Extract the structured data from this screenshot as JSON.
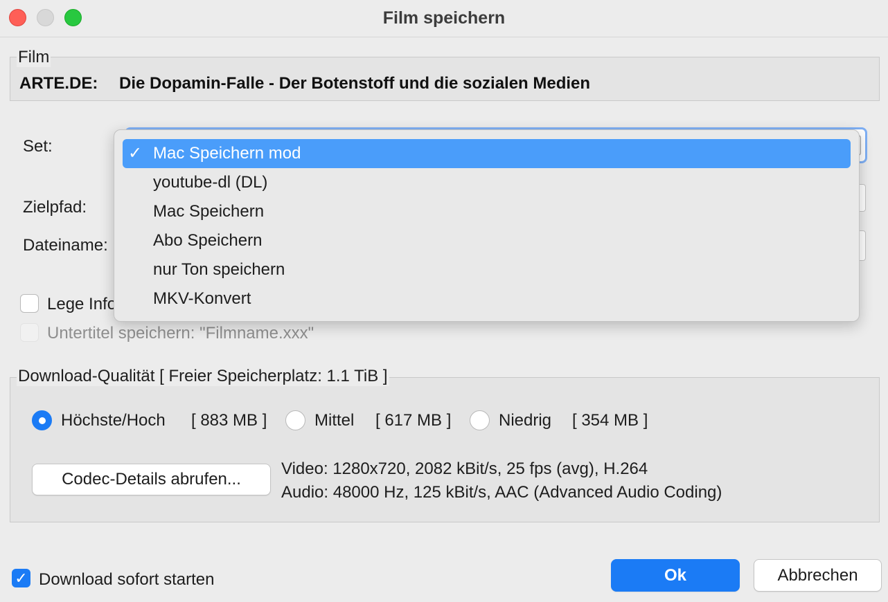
{
  "window": {
    "title": "Film speichern"
  },
  "film": {
    "legend": "Film",
    "station": "ARTE.DE:",
    "name": "Die Dopamin-Falle - Der Botenstoff und die sozialen Medien"
  },
  "form": {
    "set_label": "Set:",
    "path_label": "Zielpfad:",
    "filename_label": "Dateiname:"
  },
  "set_dropdown": {
    "selected": "Mac Speichern mod",
    "options": [
      "Mac Speichern mod",
      "youtube-dl (DL)",
      "Mac Speichern",
      "Abo Speichern",
      "nur Ton speichern",
      "MKV-Konvert"
    ],
    "check_glyph": "✓"
  },
  "options": {
    "info_label_visible": "Lege Info",
    "info_checked": false,
    "subtitle_label": "Untertitel speichern: \"Filmname.xxx\"",
    "subtitle_enabled": false
  },
  "quality": {
    "legend": "Download-Qualität [ Freier Speicherplatz: 1.1 TiB ]",
    "selected": "Höchste/Hoch",
    "choices": [
      {
        "label": "Höchste/Hoch",
        "size": "[ 883 MB ]"
      },
      {
        "label": "Mittel",
        "size": "[ 617 MB ]"
      },
      {
        "label": "Niedrig",
        "size": "[ 354 MB ]"
      }
    ],
    "codec_button": "Codec-Details abrufen...",
    "video_info": "Video: 1280x720, 2082 kBit/s, 25 fps (avg), H.264",
    "audio_info": "Audio: 48000 Hz, 125 kBit/s, AAC (Advanced Audio Coding)"
  },
  "footer": {
    "start_label": "Download sofort starten",
    "start_checked": true,
    "ok_label": "Ok",
    "cancel_label": "Abbrechen"
  },
  "colors": {
    "accent": "#1b7bf5",
    "selection": "#4a9dfa",
    "close": "#fe5f57",
    "maximize": "#28c840"
  }
}
